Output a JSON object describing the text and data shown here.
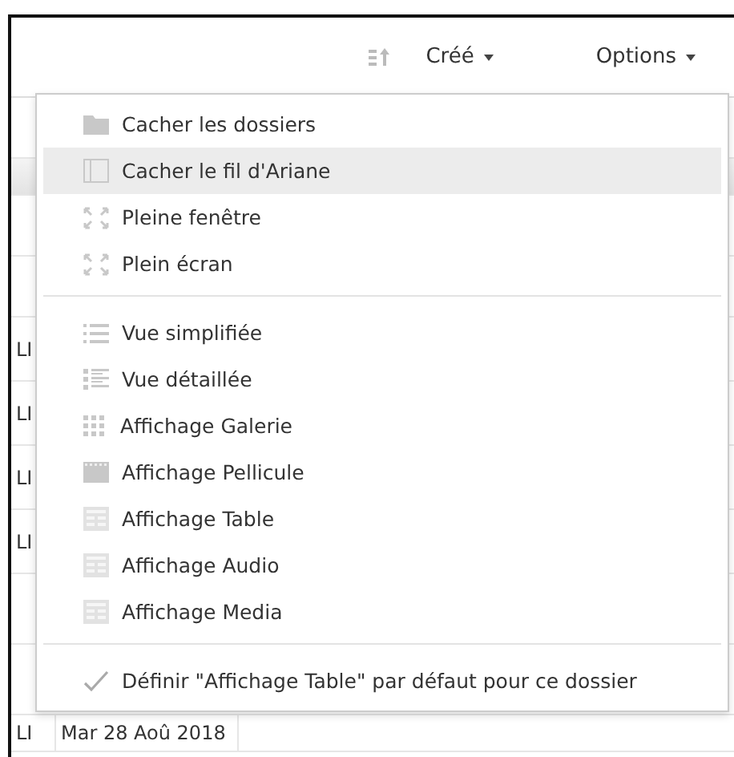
{
  "toolbar": {
    "sort_button": {
      "kind": "sort"
    },
    "sort_label": "Créé",
    "options_label": "Options"
  },
  "table": {
    "rows": [
      {
        "kind": "blank",
        "cells": []
      },
      {
        "kind": "header",
        "cells": []
      },
      {
        "kind": "blank",
        "cells": []
      },
      {
        "kind": "blank",
        "cells": []
      },
      {
        "kind": "data",
        "cells": [
          "LI"
        ]
      },
      {
        "kind": "data",
        "cells": [
          "LI"
        ]
      },
      {
        "kind": "data",
        "cells": [
          "LI"
        ]
      },
      {
        "kind": "data",
        "cells": [
          "LI"
        ]
      },
      {
        "kind": "gap",
        "cells": []
      },
      {
        "kind": "gap",
        "cells": []
      },
      {
        "kind": "last",
        "cells": [
          "LI",
          "Mar 28 Aoû 2018"
        ]
      }
    ]
  },
  "menu": {
    "sections": [
      {
        "items": [
          {
            "kind": "folder",
            "label": "Cacher les dossiers",
            "highlighted": false
          },
          {
            "kind": "panel",
            "label": "Cacher le fil d'Ariane",
            "highlighted": true
          },
          {
            "kind": "expand",
            "label": "Pleine fenêtre",
            "highlighted": false
          },
          {
            "kind": "expand",
            "label": "Plein écran",
            "highlighted": false
          }
        ]
      },
      {
        "items": [
          {
            "kind": "list",
            "label": "Vue simplifiée",
            "highlighted": false
          },
          {
            "kind": "detail",
            "label": "Vue détaillée",
            "highlighted": false
          },
          {
            "kind": "grid",
            "label": "Affichage Galerie",
            "highlighted": false
          },
          {
            "kind": "film",
            "label": "Affichage Pellicule",
            "highlighted": false
          },
          {
            "kind": "table",
            "label": "Affichage Table",
            "highlighted": false
          },
          {
            "kind": "table",
            "label": "Affichage Audio",
            "highlighted": false
          },
          {
            "kind": "table",
            "label": "Affichage Media",
            "highlighted": false
          }
        ]
      },
      {
        "items": [
          {
            "kind": "check",
            "label": "Définir \"Affichage Table\" par défaut pour ce dossier",
            "highlighted": false
          }
        ]
      }
    ]
  }
}
